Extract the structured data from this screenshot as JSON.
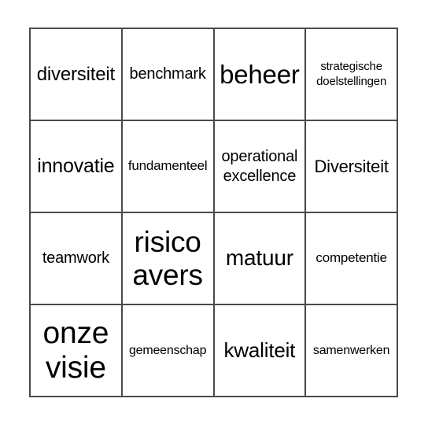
{
  "card": {
    "type": "bingo-card",
    "rows": 4,
    "columns": 4,
    "border_color": "#4a4a4a",
    "background_color": "#ffffff",
    "text_color": "#000000",
    "cells": [
      [
        {
          "text": "diversiteit",
          "marked": false
        },
        {
          "text": "benchmark",
          "marked": false
        },
        {
          "text": "beheer",
          "marked": false
        },
        {
          "text": "strategische doelstellingen",
          "marked": false
        }
      ],
      [
        {
          "text": "innovatie",
          "marked": false
        },
        {
          "text": "fundamenteel",
          "marked": false
        },
        {
          "text": "operational excellence",
          "marked": false
        },
        {
          "text": "Diversiteit",
          "marked": false
        }
      ],
      [
        {
          "text": "teamwork",
          "marked": false
        },
        {
          "text": "risico avers",
          "marked": false
        },
        {
          "text": "matuur",
          "marked": false
        },
        {
          "text": "competentie",
          "marked": false
        }
      ],
      [
        {
          "text": "onze visie",
          "marked": false
        },
        {
          "text": "gemeenschap",
          "marked": false
        },
        {
          "text": "kwaliteit",
          "marked": false
        },
        {
          "text": "samenwerken",
          "marked": false
        }
      ]
    ]
  }
}
